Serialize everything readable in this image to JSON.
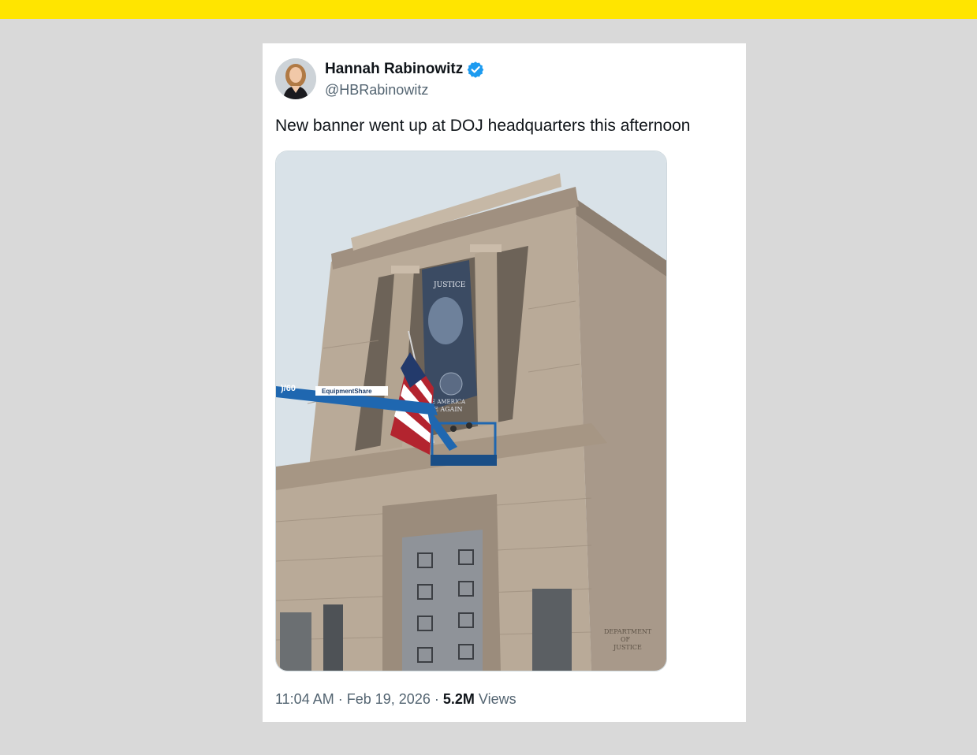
{
  "tweet": {
    "author": {
      "name": "Hannah Rabinowitz",
      "handle": "@HBRabinowitz",
      "verified": true,
      "verified_color": "#1d9bf0"
    },
    "text": "New banner went up at DOJ headquarters this afternoon",
    "media": {
      "banner_lettering": "JUSTICE",
      "banner_slogan_line1": "E AMERICA",
      "banner_slogan_line2": "E AGAIN",
      "lift_model": ")/60",
      "lift_brand": "EquipmentShare",
      "engraving_line1": "DEPARTMENT",
      "engraving_line2": "OF",
      "engraving_line3": "JUSTICE"
    },
    "time": "11:04 AM",
    "separator": "·",
    "date": "Feb 19, 2026",
    "views_count": "5.2M",
    "views_label": "Views"
  },
  "colors": {
    "top_bar": "#ffe500",
    "page_background": "#d9d9d9",
    "card_background": "#ffffff",
    "text_primary": "#0f1419",
    "text_secondary": "#536471"
  }
}
